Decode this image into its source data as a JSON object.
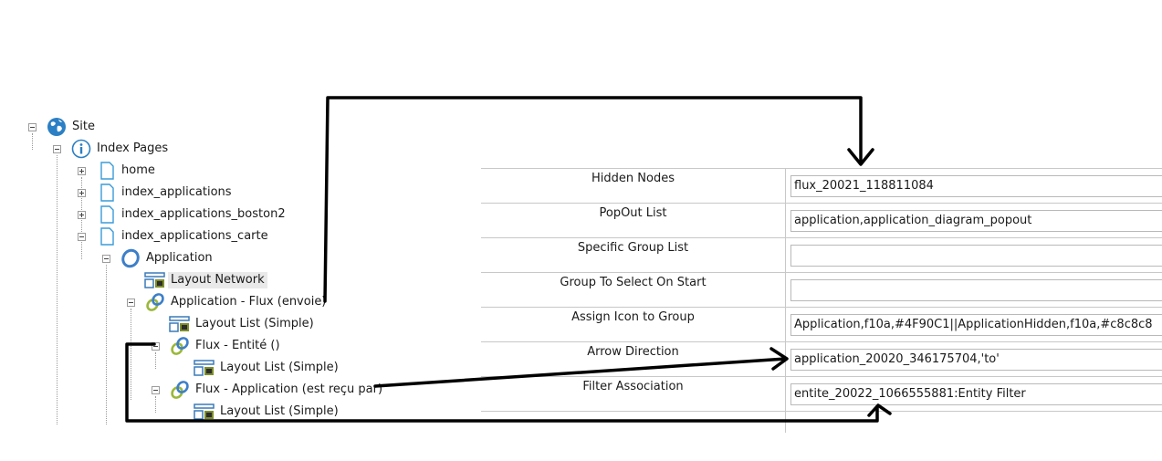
{
  "tree": {
    "nodes": [
      {
        "label": "Site",
        "icon": "globe-icon"
      },
      {
        "label": "Index Pages",
        "icon": "info-icon"
      },
      {
        "label": "home",
        "icon": "page-icon"
      },
      {
        "label": "index_applications",
        "icon": "page-icon"
      },
      {
        "label": "index_applications_boston2",
        "icon": "page-icon"
      },
      {
        "label": "index_applications_carte",
        "icon": "page-icon"
      },
      {
        "label": "Application",
        "icon": "ring-icon"
      },
      {
        "label": "Layout Network",
        "icon": "layout-icon"
      },
      {
        "label": "Application - Flux (envoie)",
        "icon": "link-icon"
      },
      {
        "label": "Layout List (Simple)",
        "icon": "layout-icon"
      },
      {
        "label": "Flux - Entité ()",
        "icon": "link-icon"
      },
      {
        "label": "Layout List (Simple)",
        "icon": "layout-icon"
      },
      {
        "label": "Flux - Application (est reçu par)",
        "icon": "link-icon"
      },
      {
        "label": "Layout List (Simple)",
        "icon": "layout-icon"
      }
    ]
  },
  "properties": [
    {
      "name": "Hidden Nodes",
      "value": "flux_20021_118811084"
    },
    {
      "name": "PopOut List",
      "value": "application,application_diagram_popout"
    },
    {
      "name": "Specific Group List",
      "value": ""
    },
    {
      "name": "Group To Select On Start",
      "value": ""
    },
    {
      "name": "Assign Icon to Group",
      "value": "Application,f10a,#4F90C1||ApplicationHidden,f10a,#c8c8c8"
    },
    {
      "name": "Arrow Direction",
      "value": "application_20020_346175704,'to'"
    },
    {
      "name": "Filter Association",
      "value": "entite_20022_1066555881:Entity Filter"
    }
  ],
  "colors": {
    "globe": "#2b7fc4",
    "page": "#3a9bd8",
    "ring": "#3d7fc9",
    "link_green": "#9ab83a",
    "link_blue": "#3d7fc9",
    "annotation": "#000000"
  }
}
